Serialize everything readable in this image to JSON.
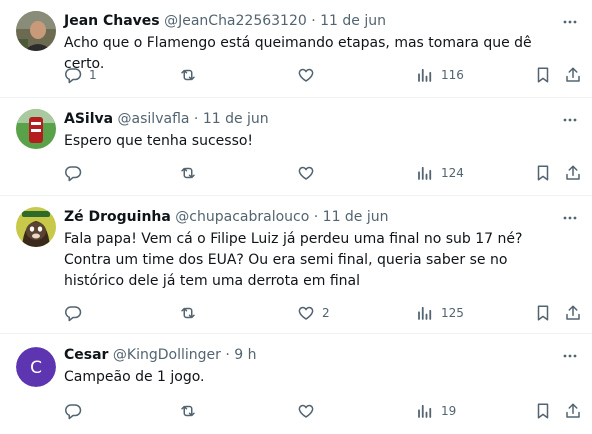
{
  "tweets": [
    {
      "name": "Jean Chaves",
      "handle": "@JeanCha22563120",
      "dot": "·",
      "time": "11 de jun",
      "text": "Acho que o Flamengo está queimando etapas, mas tomara que dê certo.",
      "replies": "1",
      "retweets": "",
      "likes": "",
      "views": "116",
      "avatar": "photo"
    },
    {
      "name": "ASilva",
      "handle": "@asilvafla",
      "dot": "·",
      "time": "11 de jun",
      "text": "Espero que tenha sucesso!",
      "replies": "",
      "retweets": "",
      "likes": "",
      "views": "124",
      "avatar": "photo"
    },
    {
      "name": "Zé Droguinha",
      "handle": "@chupacabralouco",
      "dot": "·",
      "time": "11 de jun",
      "text": "Fala papa! Vem cá o Filipe Luiz já perdeu uma final no sub 17 né? Contra um time dos EUA? Ou era semi final, queria saber se no histórico dele já tem uma derrota em final",
      "replies": "",
      "retweets": "",
      "likes": "2",
      "views": "125",
      "avatar": "photo"
    },
    {
      "name": "Cesar",
      "handle": "@KingDollinger",
      "dot": "·",
      "time": "9 h",
      "text": "Campeão de 1 jogo.",
      "replies": "",
      "retweets": "",
      "likes": "",
      "views": "19",
      "avatar_letter": "C",
      "avatar_color": "#5e35b1"
    }
  ],
  "colors": {
    "secondary": "#536471",
    "divider": "#eff3f4"
  },
  "icons": [
    "more-icon",
    "reply-icon",
    "retweet-icon",
    "like-icon",
    "views-icon",
    "bookmark-icon",
    "share-icon"
  ]
}
